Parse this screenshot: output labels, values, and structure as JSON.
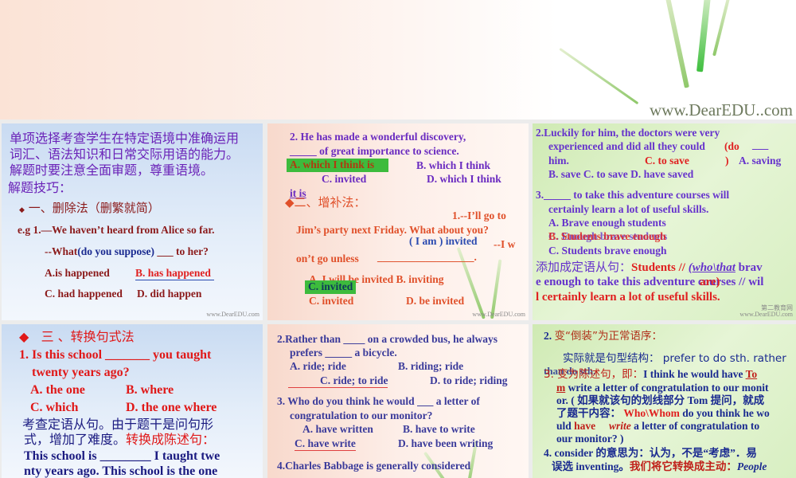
{
  "banner": {
    "brand": "www.DearEDU..com"
  },
  "watermark": "www.DearEDU.com",
  "watermark2": "第二教育网",
  "p1": {
    "intro": [
      "单项选择考查学生在特定语境中准确运用",
      "词汇、语法知识和日常交际用语的能力。",
      "解题时要注意全面审题，尊重语境。"
    ],
    "tips": "解题技巧：",
    "method": "一、删除法（删繁就简）",
    "q1": "e.g 1.—We haven’t heard from Alice so far.",
    "q1b_pre": "--What",
    "q1b_paren": "(do you suppose)",
    "q1b_post": "___  to her?",
    "optA": "A.is happened",
    "optB": "B. has happened",
    "optC": "C. had happened",
    "optD": "D. did happen"
  },
  "p2": {
    "q2a": "2. He has made a wonderful discovery,",
    "q2b": "_____   of great importance to science.",
    "answer": "A. which I think is",
    "optB": "B. which I think",
    "optC": "C. invited",
    "optD": "D. which I think",
    "optD2": "it is",
    "method": "二、增补法：",
    "q1a": "1.--I’ll go to",
    "q1b": "Jim’s party next Friday. What      about you?",
    "insert": "( I  am ) invited",
    "q1c": "--I w",
    "q1d": "on’t go unless",
    "blank": "__________________.",
    "optA": "A. I will be invited  B. inviting",
    "answer2": "C. invited",
    "optD2b": "D. be invited"
  },
  "p3": {
    "q2": [
      "2.Luckily for him, the doctors were very",
      "experienced and did all they could",
      "him."
    ],
    "paren": "(do",
    "blank": "___",
    "answer": "C. to save",
    "close": ")",
    "optA": "A. saving",
    "opts": "B. save  C. to save  D. have saved",
    "q3": [
      "3._____ to take this adventure courses will",
      "certainly learn a lot of useful skills."
    ],
    "optA3": "A. Brave enough students",
    "optB3": "B. Students brave enough",
    "optB3b": "C. Enough brave students",
    "optC3": "C. Students brave enough",
    "note_cn": "添加成定语从句：",
    "note_a": "Students // ",
    "note_who": "(who\\that",
    "note_brav": "  brav",
    "note_b": "e enough  to take this adventure courses // wil",
    "note_are": "are)",
    "note_c": "l certainly learn a lot of useful skills."
  },
  "p4": {
    "method": "三 、转换句式法",
    "q1a": "1. Is this school _______ you taught",
    "q1b": "twenty years ago?",
    "optA": "A. the one",
    "optB": "B. where",
    "optC": "C. which",
    "optD": "D. the one where",
    "cn1": "考查定语从句。由于题干是问句形",
    "cn2a": "式，增加了难度。",
    "cn2b": "转换成陈述句：",
    "s1": "This school is ________ I  taught twe",
    "s2": "nty years ago.  This school is the one"
  },
  "p5": {
    "q2a": "2.Rather than ____ on a crowded bus, he always",
    "q2b": "prefers _____ a bicycle.",
    "optA": "A. ride;  ride",
    "optB": "B. riding;  ride",
    "optC": "C. ride;  to ride",
    "optD": "D. to ride; riding",
    "q3a": "3. Who do you think he would ___ a letter of",
    "q3b": "congratulation to our monitor?",
    "optA3": "A. have written",
    "optB3": "B. have to write",
    "optC3": "C. have write",
    "optD3": "D. have been writing",
    "q4": "4.Charles Babbage is generally considered"
  },
  "p6": {
    "h2": "2.",
    "h2cn": "变“倒装”为正常语序：",
    "l1": "实际就是句型结构： prefer to do sth.  rather",
    "l1b": "than do sth.",
    "l2cn": "3. 变为陈述句，即：",
    "l2": "I think he would have ",
    "tom1": "To",
    "tom2": "m",
    "l3": " write a letter of congratulation to our monit",
    "l4": "or. ( 如果就该句的划线部分 Tom 提问，就成",
    "l5a": "了题干内容： ",
    "l5who": "Who\\Whom",
    "l5b": " do you think he wo",
    "l6a": "uld ",
    "l6have": "have",
    "l6write": "write",
    "l6b": " a letter of congratulation to",
    "l7": "our monitor? )",
    "l8": "4. consider  的意思为：认为，不是“考虑”．易",
    "l9a": "误选 inventing。",
    "l9b": "我们将它转换成主动：",
    "l9c": "People"
  }
}
